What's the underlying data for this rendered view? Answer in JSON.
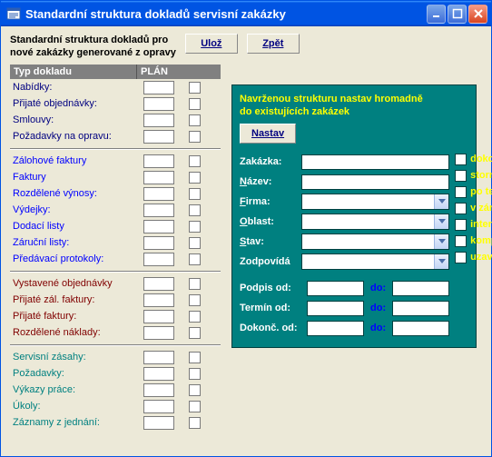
{
  "window": {
    "title": "Standardní struktura dokladů servisní zakázky"
  },
  "header": {
    "subtitle_line1": "Standardní struktura dokladů pro",
    "subtitle_line2": "nové zakázky generované z opravy",
    "save": "Ulož",
    "back": "Zpět"
  },
  "table": {
    "col1": "Typ dokladu",
    "col2": "PLÁN",
    "groups": [
      {
        "color": "navy",
        "rows": [
          "Nabídky:",
          "Přijaté objednávky:",
          "Smlouvy:",
          "Požadavky na opravu:"
        ]
      },
      {
        "color": "blue",
        "rows": [
          "Zálohové faktury",
          "Faktury",
          "Rozdělené výnosy:",
          "Výdejky:",
          "Dodací listy",
          "Záruční listy:",
          "Předávací protokoly:"
        ]
      },
      {
        "color": "maroon",
        "rows": [
          "Vystavené objednávky",
          "Přijaté zál. faktury:",
          "Přijaté faktury:",
          "Rozdělené náklady:"
        ]
      },
      {
        "color": "teal",
        "rows": [
          "Servisní zásahy:",
          "Požadavky:",
          "Výkazy práce:",
          "Úkoly:",
          "Záznamy z jednání:"
        ]
      }
    ]
  },
  "panel": {
    "title_line1": "Navrženou strukturu nastav hromadně",
    "title_line2": "do existujících zakázek",
    "apply": "Nastav",
    "fields": {
      "zakazka": "Zakázka:",
      "nazev_pre": "N",
      "nazev_post": "ázev:",
      "firma_pre": "F",
      "firma_post": "irma:",
      "oblast_pre": "O",
      "oblast_post": "blast:",
      "stav_pre": "S",
      "stav_post": "tav:",
      "zodpovida": "Zodpovídá"
    },
    "checks": [
      "dokončené",
      "stornované",
      "po termínu",
      "v záruce",
      "interní",
      "kompletní",
      "uzavřené"
    ],
    "dates": {
      "podpis": "Podpis od:",
      "termin": "Termín od:",
      "dokonc": "Dokonč. od:",
      "do": "do:"
    }
  }
}
